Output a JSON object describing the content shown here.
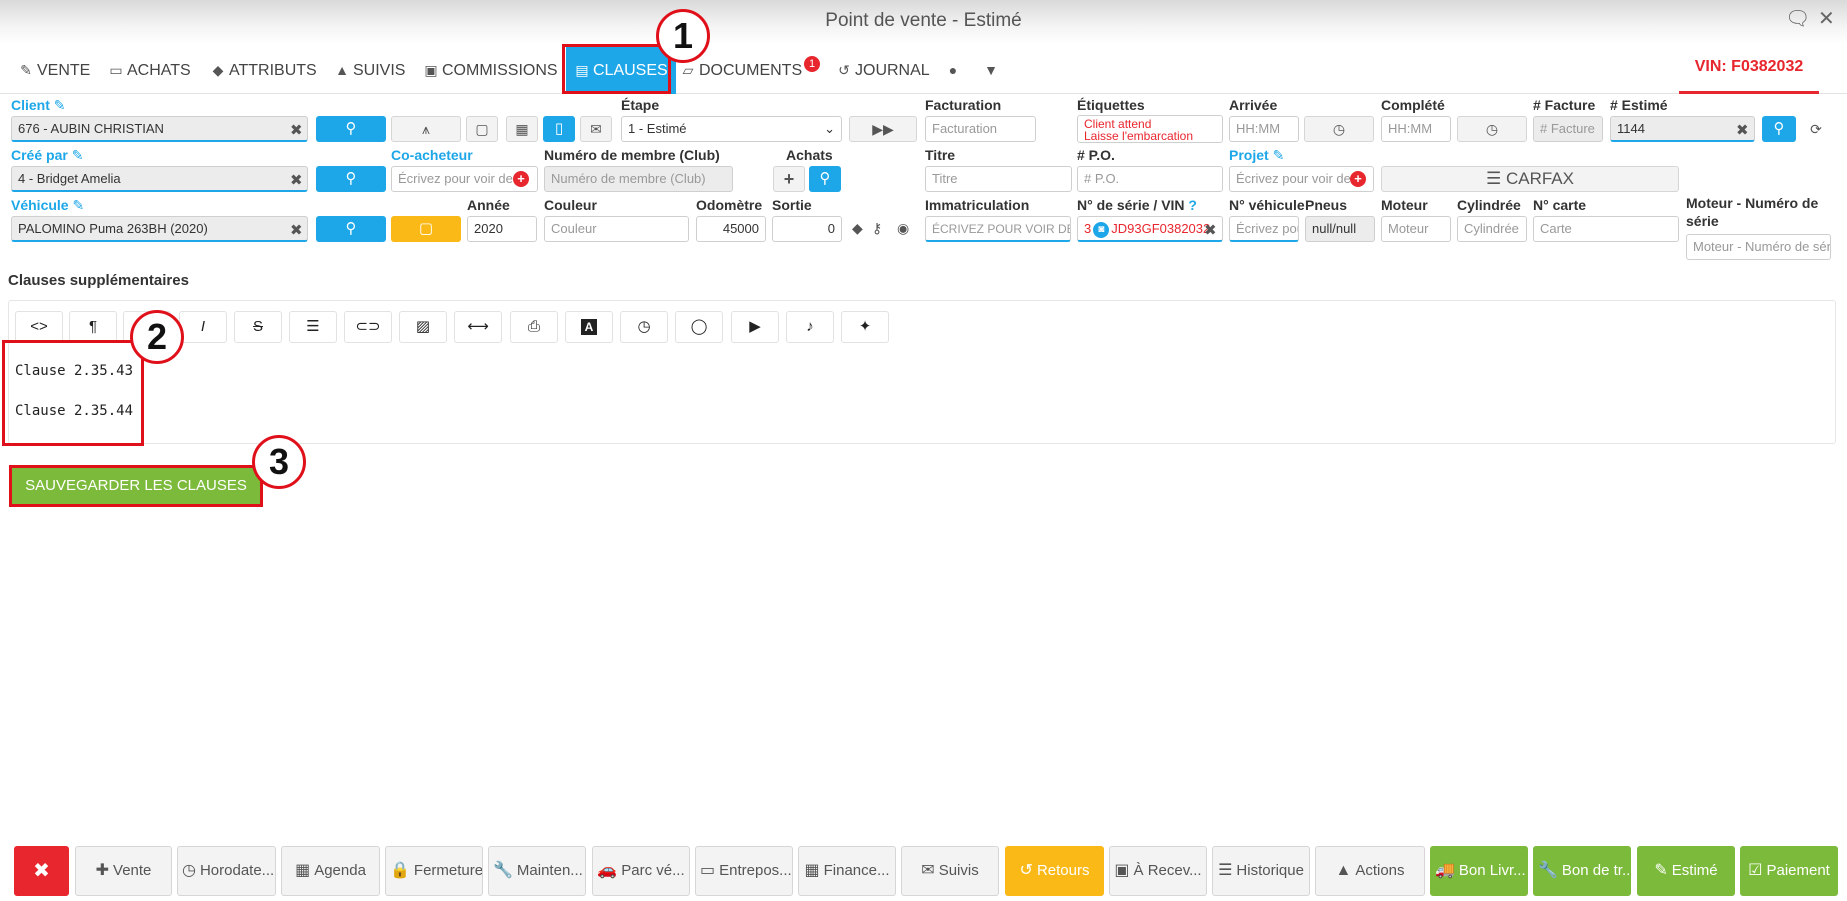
{
  "window": {
    "title": "Point de vente - Estimé"
  },
  "tabs": [
    {
      "label": "VENTE",
      "icon": "edit-icon"
    },
    {
      "label": "ACHATS",
      "icon": "card-icon"
    },
    {
      "label": "ATTRIBUTS",
      "icon": "tags-icon"
    },
    {
      "label": "SUIVIS",
      "icon": "bell-icon"
    },
    {
      "label": "COMMISSIONS",
      "icon": "money-icon"
    },
    {
      "label": "CLAUSES",
      "icon": "file-icon",
      "active": true
    },
    {
      "label": "DOCUMENTS",
      "icon": "folder-icon",
      "badge": "1"
    },
    {
      "label": "JOURNAL",
      "icon": "history-icon"
    }
  ],
  "vin_header": "VIN: F0382032",
  "form": {
    "client": {
      "label": "Client",
      "value": "676 - AUBIN CHRISTIAN"
    },
    "etape": {
      "label": "Étape",
      "value": "1 - Estimé"
    },
    "facturation": {
      "label": "Facturation",
      "placeholder": "Facturation"
    },
    "etiquettes": {
      "label": "Étiquettes",
      "value": "Client attend",
      "value2": "Laisse l'embarcation"
    },
    "arrivee": {
      "label": "Arrivée",
      "placeholder": "HH:MM"
    },
    "complete": {
      "label": "Complété",
      "placeholder": "HH:MM"
    },
    "facture_no": {
      "label": "# Facture",
      "placeholder": "# Facture"
    },
    "estime_no": {
      "label": "# Estimé",
      "value": "1144"
    },
    "cree_par": {
      "label": "Créé par",
      "value": "4 - Bridget Amelia"
    },
    "co_acheteur": {
      "label": "Co-acheteur",
      "placeholder": "Écrivez pour voir des"
    },
    "membre": {
      "label": "Numéro de membre (Club)",
      "placeholder": "Numéro de membre (Club)"
    },
    "achats": {
      "label": "Achats"
    },
    "titre": {
      "label": "Titre",
      "placeholder": "Titre"
    },
    "po": {
      "label": "# P.O.",
      "placeholder": "# P.O."
    },
    "projet": {
      "label": "Projet",
      "placeholder": "Écrivez pour voir des"
    },
    "carfax": "CARFAX",
    "vehicule": {
      "label": "Véhicule",
      "value": "PALOMINO Puma 263BH (2020)"
    },
    "annee": {
      "label": "Année",
      "value": "2020"
    },
    "couleur": {
      "label": "Couleur",
      "placeholder": "Couleur"
    },
    "odometre": {
      "label": "Odomètre",
      "value": "45000"
    },
    "sortie": {
      "label": "Sortie",
      "value": "0"
    },
    "immatriculation": {
      "label": "Immatriculation",
      "placeholder": "ÉCRIVEZ POUR VOIR DES"
    },
    "serie_vin": {
      "label": "N° de série / VIN",
      "value": "JD93GF0382032",
      "prefix": "3"
    },
    "no_vehicule": {
      "label": "N° véhicule",
      "placeholder": "Écrivez pou"
    },
    "pneus": {
      "label": "Pneus",
      "value": "null/null"
    },
    "moteur": {
      "label": "Moteur",
      "placeholder": "Moteur"
    },
    "cylindree": {
      "label": "Cylindrée",
      "placeholder": "Cylindrée"
    },
    "no_carte": {
      "label": "N° carte",
      "placeholder": "Carte"
    },
    "moteur_serie": {
      "label1": "Moteur - Numéro de",
      "label2": "série",
      "placeholder": "Moteur - Numéro de série"
    }
  },
  "clauses": {
    "heading": "Clauses supplémentaires",
    "toolbar": [
      "<>",
      "¶",
      "B",
      "I",
      "S",
      "list",
      "link",
      "image",
      "hr",
      "print",
      "A",
      "clock",
      "comment",
      "play",
      "mic",
      "magic"
    ],
    "toolbar_text": {
      "code": "<>",
      "paragraph": "¶",
      "italic": "I",
      "strike": "S",
      "font": "A"
    },
    "lines": [
      "Clause 2.35.43",
      "Clause 2.35.44"
    ],
    "save_label": "SAUVEGARDER LES CLAUSES"
  },
  "annotations": [
    "1",
    "2",
    "3"
  ],
  "bottom_bar": [
    {
      "label": "",
      "icon": "close-icon",
      "style": "red"
    },
    {
      "label": "Vente",
      "icon": "plus-icon"
    },
    {
      "label": "Horodate...",
      "icon": "clock-icon"
    },
    {
      "label": "Agenda",
      "icon": "calendar-icon"
    },
    {
      "label": "Fermeture",
      "icon": "lock-icon"
    },
    {
      "label": "Mainten...",
      "icon": "wrench-icon"
    },
    {
      "label": "Parc vé...",
      "icon": "car-icon"
    },
    {
      "label": "Entrepos...",
      "icon": "archive-icon"
    },
    {
      "label": "Finance...",
      "icon": "calculator-icon"
    },
    {
      "label": "Suivis",
      "icon": "envelope-icon"
    },
    {
      "label": "Retours",
      "icon": "undo-icon",
      "style": "yellow"
    },
    {
      "label": "À Recev...",
      "icon": "money-icon"
    },
    {
      "label": "Historique",
      "icon": "list-icon"
    },
    {
      "label": "Actions",
      "icon": "caret-up-icon"
    },
    {
      "label": "Bon Livr...",
      "icon": "truck-icon",
      "style": "green"
    },
    {
      "label": "Bon de tr...",
      "icon": "wrench-icon",
      "style": "green"
    },
    {
      "label": "Estimé",
      "icon": "edit-icon",
      "style": "green"
    },
    {
      "label": "Paiement",
      "icon": "check-icon",
      "style": "green"
    }
  ]
}
